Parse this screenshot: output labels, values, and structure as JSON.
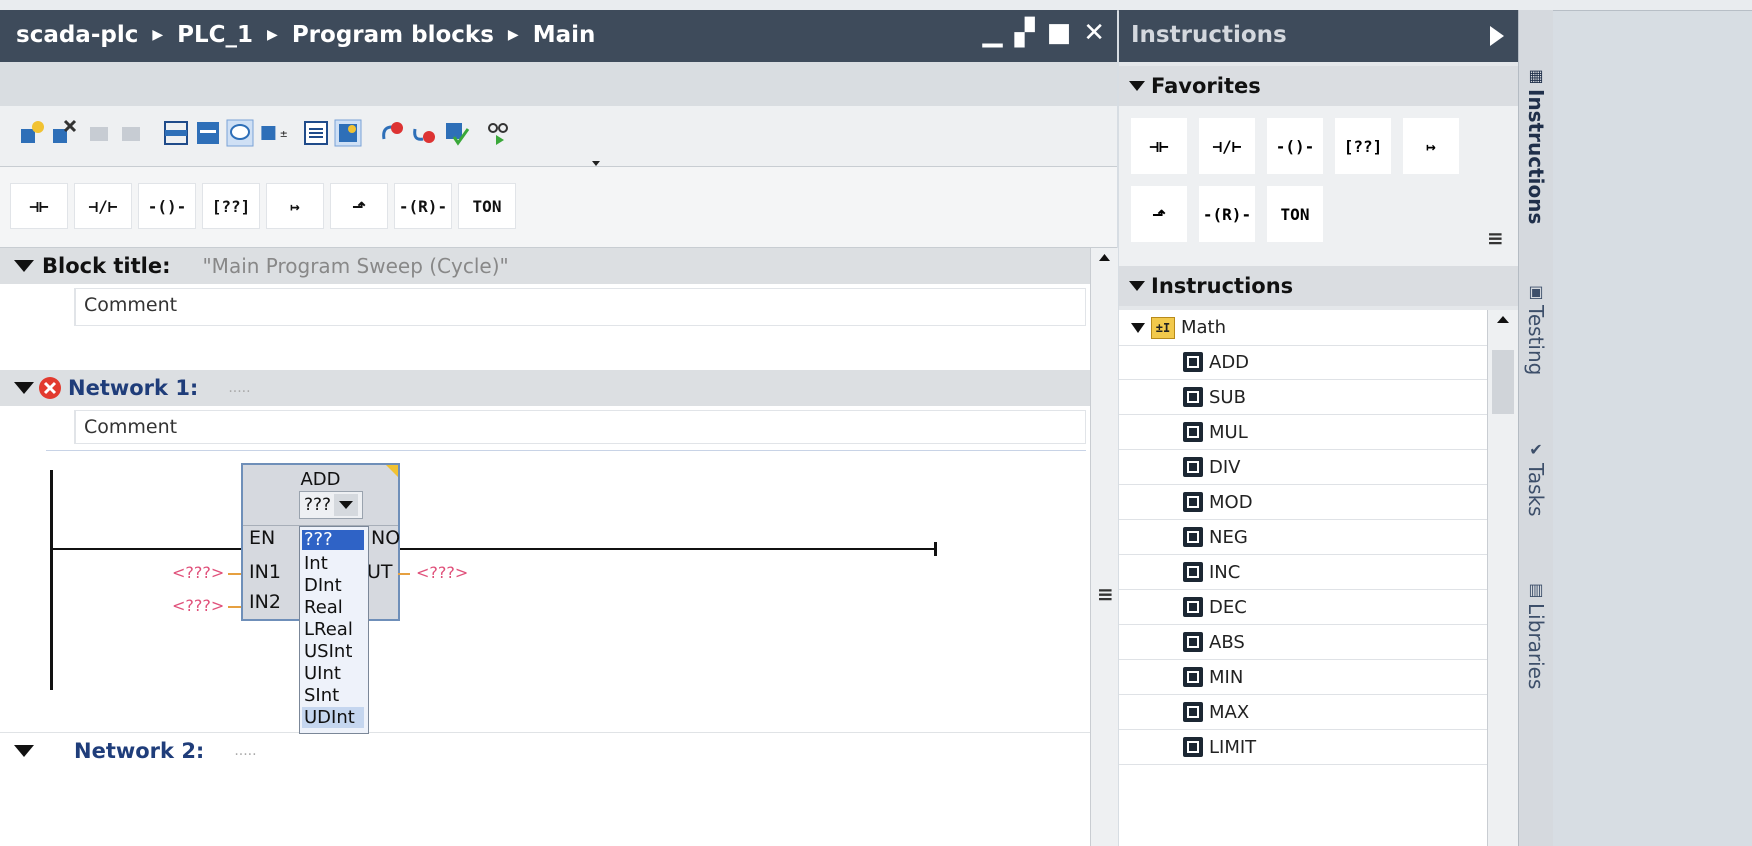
{
  "editor": {
    "breadcrumb": [
      "scada-plc",
      "PLC_1",
      "Program blocks",
      "Main"
    ],
    "block_title_label": "Block title:",
    "block_title_value": "\"Main Program Sweep (Cycle)\"",
    "comment_placeholder": "Comment",
    "networks": [
      {
        "title": "Network 1:",
        "dots": ".....",
        "comment": "Comment",
        "has_error": true
      },
      {
        "title": "Network 2:",
        "dots": "....."
      }
    ],
    "ladder_buttons": [
      "⊣⊢",
      "⊣/⊢",
      "-()-",
      "[??]",
      "↦",
      "⬏",
      "-(R)-",
      "TON"
    ]
  },
  "add_block": {
    "name": "ADD",
    "type_value": "???",
    "pins": {
      "en": "EN",
      "eno": "NO",
      "in1": "IN1",
      "in2": "IN2",
      "out": "UT"
    },
    "operand_in1": "<???>",
    "operand_in2": "<???>",
    "operand_out": "<???>",
    "type_options": [
      "???",
      "Int",
      "DInt",
      "Real",
      "LReal",
      "USInt",
      "UInt",
      "SInt",
      "UDInt"
    ],
    "selected_option": "???"
  },
  "instructions_panel": {
    "title": "Instructions",
    "favorites_header": "Favorites",
    "favorites": [
      "⊣⊢",
      "⊣/⊢",
      "-()-",
      "[??]",
      "↦",
      "⬏",
      "-(R)-",
      "TON"
    ],
    "instructions_header": "Instructions",
    "folder": "Math",
    "items": [
      "ADD",
      "SUB",
      "MUL",
      "DIV",
      "MOD",
      "NEG",
      "INC",
      "DEC",
      "ABS",
      "MIN",
      "MAX",
      "LIMIT"
    ]
  },
  "side_tabs": [
    "Instructions",
    "Testing",
    "Tasks",
    "Libraries"
  ],
  "colors": {
    "titlebar": "#3e4b5b",
    "network_title": "#1f3d7a",
    "operand_red": "#e0507a",
    "selection_blue": "#2f63c6"
  }
}
